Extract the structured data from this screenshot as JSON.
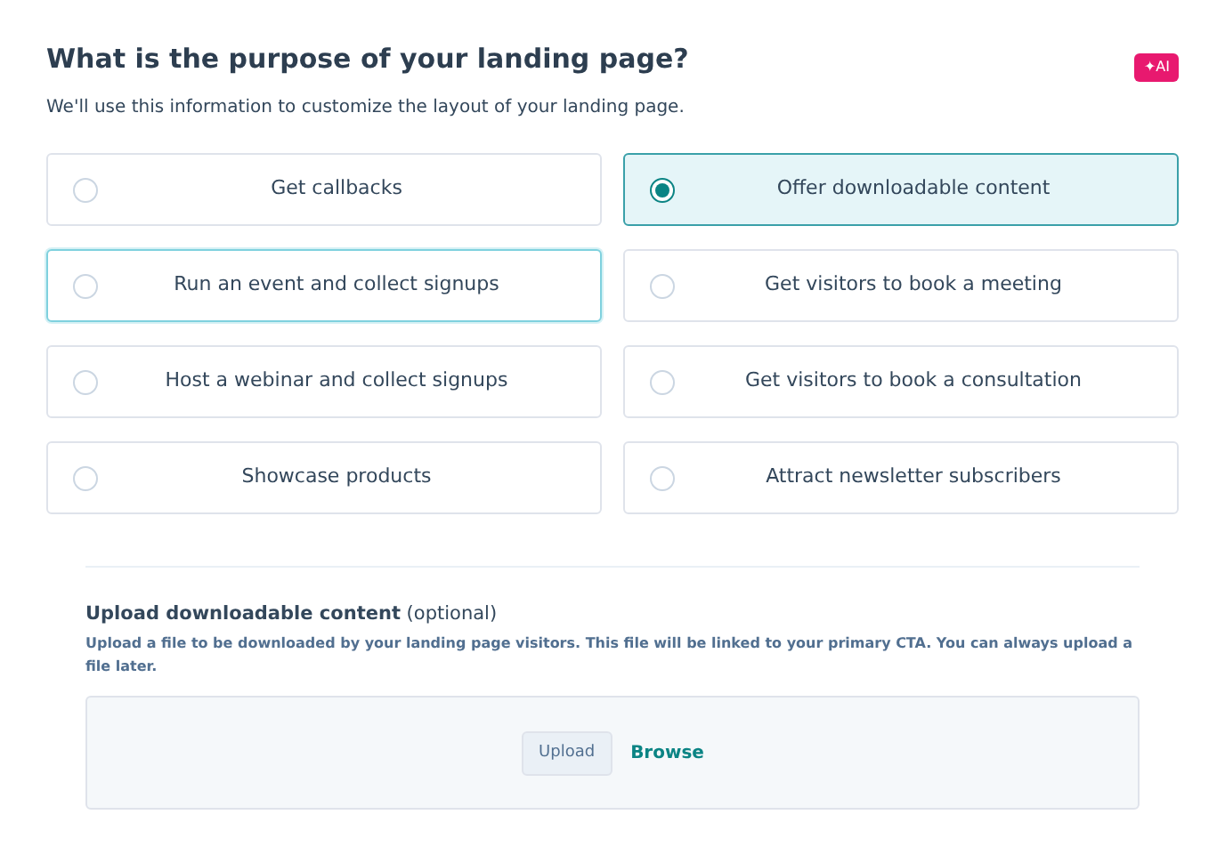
{
  "header": {
    "title": "What is the purpose of your landing page?",
    "ai_badge": "✦AI",
    "subtitle": "We'll use this information to customize the layout of your landing page."
  },
  "options": [
    {
      "label": "Get callbacks",
      "selected": false,
      "hovered": false
    },
    {
      "label": "Offer downloadable content",
      "selected": true,
      "hovered": false
    },
    {
      "label": "Run an event and collect signups",
      "selected": false,
      "hovered": true
    },
    {
      "label": "Get visitors to book a meeting",
      "selected": false,
      "hovered": false
    },
    {
      "label": "Host a webinar and collect signups",
      "selected": false,
      "hovered": false
    },
    {
      "label": "Get visitors to book a consultation",
      "selected": false,
      "hovered": false
    },
    {
      "label": "Showcase products",
      "selected": false,
      "hovered": false
    },
    {
      "label": "Attract newsletter subscribers",
      "selected": false,
      "hovered": false
    }
  ],
  "upload": {
    "label": "**Upload downloadable content** (optional)",
    "help": "Upload a file to be downloaded by your landing page visitors. This file will be linked to your primary CTA. You can always upload a file later.",
    "upload_button": "Upload",
    "browse_link": "Browse"
  }
}
